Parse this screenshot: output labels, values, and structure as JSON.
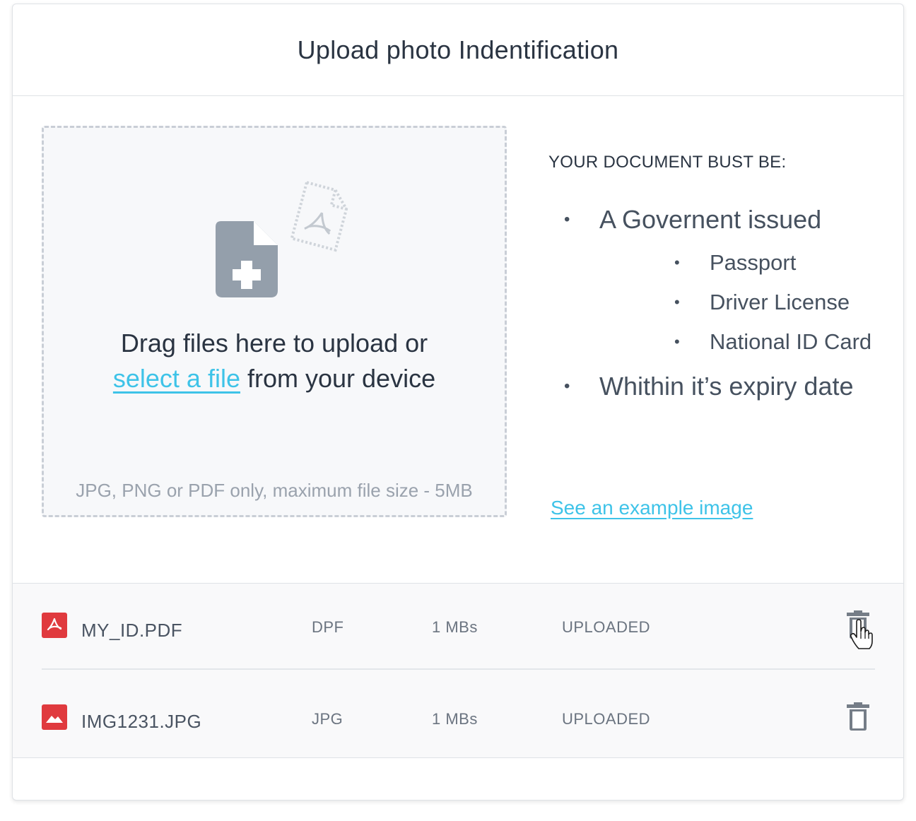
{
  "header": {
    "title": "Upload photo Indentification"
  },
  "dropzone": {
    "text_before": "Drag files here to upload or",
    "link_text": "select a file",
    "text_after": "from your device",
    "hint": "JPG, PNG or PDF only, maximum file size - 5MB"
  },
  "requirements": {
    "title": "YOUR DOCUMENT BUST BE:",
    "items": [
      {
        "label": "A Governent issued",
        "subitems": [
          "Passport",
          "Driver License",
          "National ID Card"
        ]
      },
      {
        "label": "Whithin it’s expiry date"
      }
    ],
    "example_link": "See an example image"
  },
  "files": [
    {
      "name": "MY_ID.PDF",
      "type": "DPF",
      "size": "1 MBs",
      "status": "UPLOADED",
      "icon": "pdf-file-icon"
    },
    {
      "name": "IMG1231.JPG",
      "type": "JPG",
      "size": "1 MBs",
      "status": "UPLOADED",
      "icon": "image-file-icon"
    }
  ],
  "colors": {
    "accent": "#3ec3e8",
    "file_badge": "#e03a3e",
    "icon_gray": "#949fab",
    "text_dark": "#2a3442"
  }
}
